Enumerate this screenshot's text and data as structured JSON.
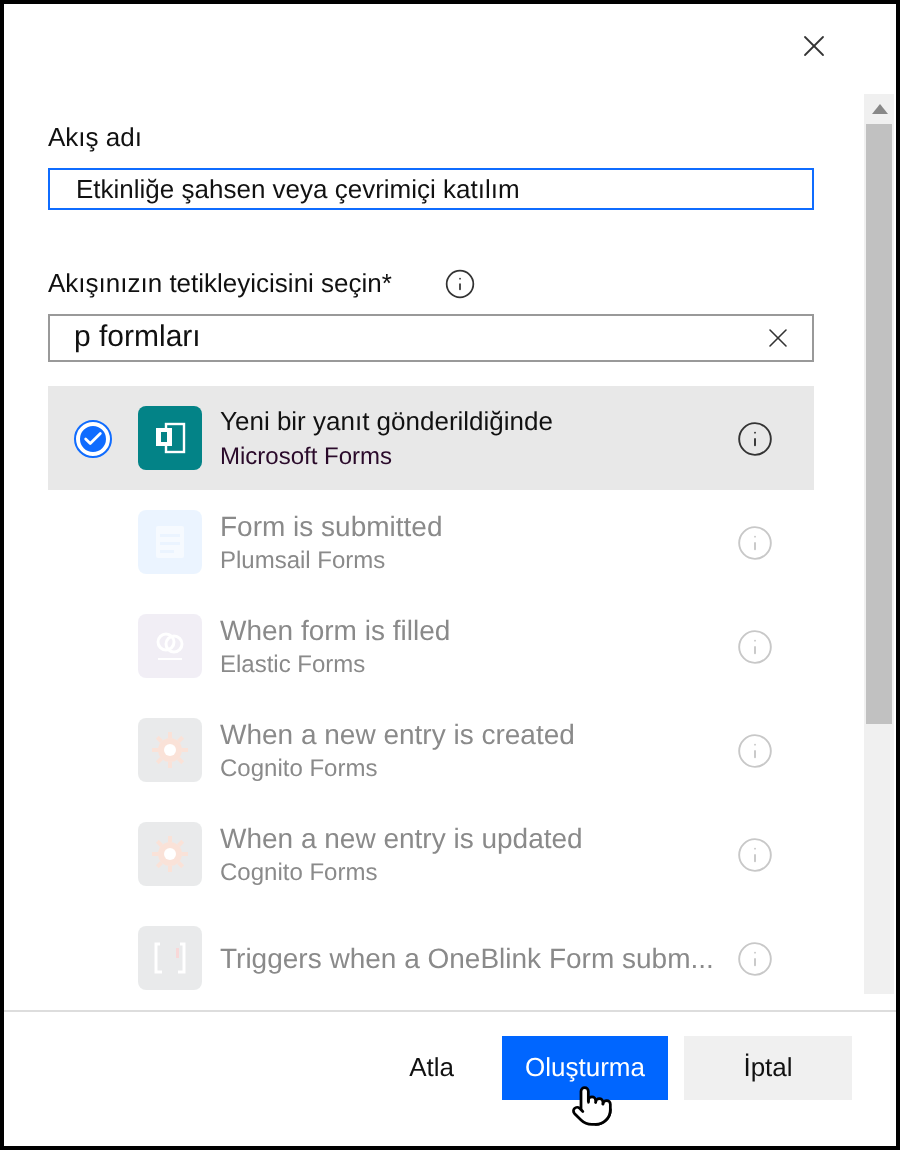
{
  "flow_name": {
    "label": "Akış adı",
    "value": "Etkinliğe şahsen veya çevrimiçi katılım"
  },
  "trigger": {
    "label": "Akışınızın tetikleyicisini seçin*",
    "search": {
      "value": "p formları"
    }
  },
  "triggers": [
    {
      "title": "Yeni bir yanıt gönderildiğinde",
      "connector": "Microsoft Forms",
      "kind": "msforms",
      "selected": true,
      "disabled": false
    },
    {
      "title": "Form is submitted",
      "connector": "Plumsail Forms",
      "kind": "plumsail",
      "selected": false,
      "disabled": true
    },
    {
      "title": "When form is filled",
      "connector": "Elastic Forms",
      "kind": "elastic",
      "selected": false,
      "disabled": true
    },
    {
      "title": "When a new entry is created",
      "connector": "Cognito Forms",
      "kind": "cognito",
      "selected": false,
      "disabled": true
    },
    {
      "title": "When a new entry is updated",
      "connector": "Cognito Forms",
      "kind": "cognito",
      "selected": false,
      "disabled": true
    },
    {
      "title": "Triggers when a OneBlink Form subm...",
      "kind": "oneblink",
      "selected": false,
      "disabled": true
    }
  ],
  "buttons": [
    {
      "label": "Atla",
      "kind": "link"
    },
    {
      "label": "Oluşturma",
      "kind": "primary"
    },
    {
      "label": "İptal",
      "kind": "secondary"
    }
  ]
}
